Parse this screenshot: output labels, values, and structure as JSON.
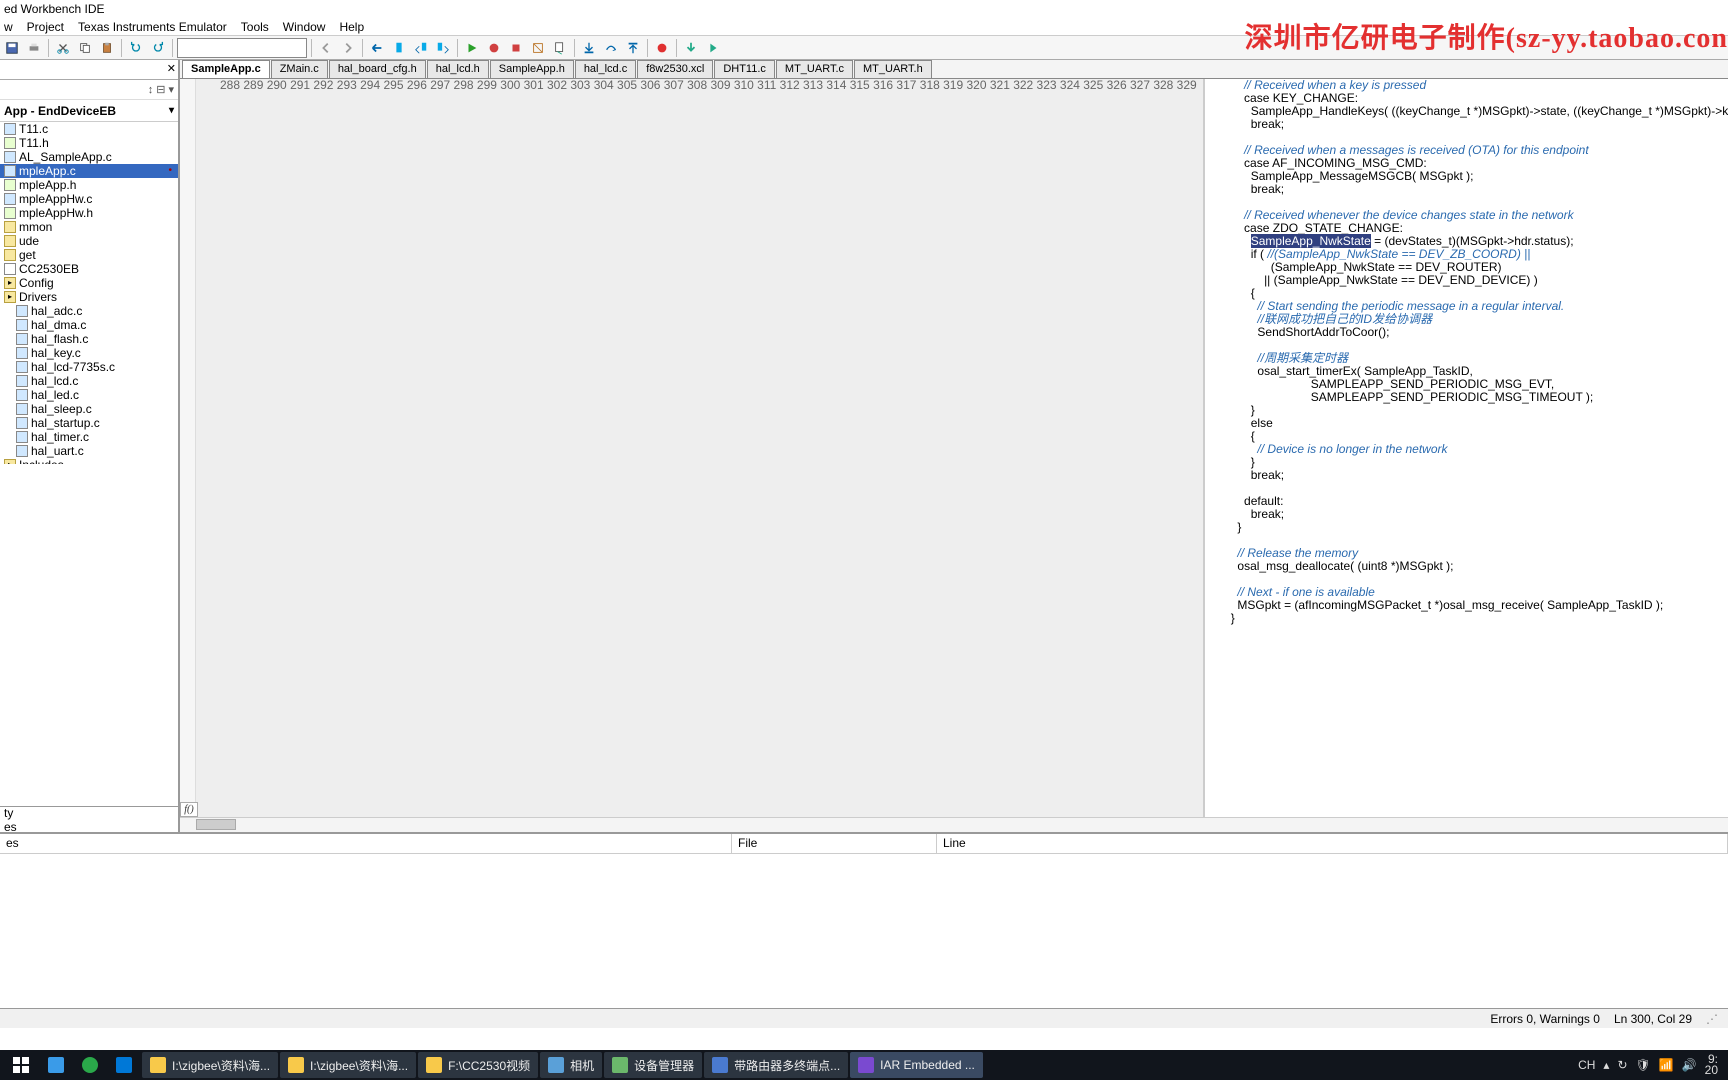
{
  "title": "ed Workbench IDE",
  "watermark": "深圳市亿研电子制作(sz-yy.taobao.con",
  "menu": [
    "w",
    "Project",
    "Texas Instruments Emulator",
    "Tools",
    "Window",
    "Help"
  ],
  "project_label": "App - EndDeviceEB",
  "tree": [
    {
      "n": "T11.c",
      "t": "c"
    },
    {
      "n": "T11.h",
      "t": "h"
    },
    {
      "n": "AL_SampleApp.c",
      "t": "c"
    },
    {
      "n": "mpleApp.c",
      "t": "c",
      "active": true,
      "mark": "•"
    },
    {
      "n": "mpleApp.h",
      "t": "h"
    },
    {
      "n": "mpleAppHw.c",
      "t": "c"
    },
    {
      "n": "mpleAppHw.h",
      "t": "h"
    }
  ],
  "folders1": [
    {
      "n": "mmon"
    },
    {
      "n": "ude"
    },
    {
      "n": "get"
    },
    {
      "n": "CC2530EB",
      "plain": true
    },
    {
      "n": "Config",
      "fold": true
    },
    {
      "n": "Drivers",
      "fold": true
    }
  ],
  "drivers": [
    {
      "n": "hal_adc.c"
    },
    {
      "n": "hal_dma.c"
    },
    {
      "n": "hal_flash.c"
    },
    {
      "n": "hal_key.c"
    },
    {
      "n": "hal_lcd-7735s.c"
    },
    {
      "n": "hal_lcd.c"
    },
    {
      "n": "hal_led.c"
    },
    {
      "n": "hal_sleep.c"
    },
    {
      "n": "hal_startup.c"
    },
    {
      "n": "hal_timer.c"
    },
    {
      "n": "hal_uart.c"
    }
  ],
  "folders2": [
    {
      "n": "Includes",
      "fold": true
    }
  ],
  "sidebot": [
    "ty",
    "es"
  ],
  "tabs": [
    "SampleApp.c",
    "ZMain.c",
    "hal_board_cfg.h",
    "hal_lcd.h",
    "SampleApp.h",
    "hal_lcd.c",
    "f8w2530.xcl",
    "DHT11.c",
    "MT_UART.c",
    "MT_UART.h"
  ],
  "active_tab": 0,
  "code_start": 288,
  "code_lines": [
    {
      "t": "          // Received when a key is pressed",
      "cm": [
        10,
        80
      ]
    },
    {
      "t": "          case KEY_CHANGE:"
    },
    {
      "t": "            SampleApp_HandleKeys( ((keyChange_t *)MSGpkt)->state, ((keyChange_t *)MSGpkt)->keys );"
    },
    {
      "t": "            break;"
    },
    {
      "t": ""
    },
    {
      "t": "          // Received when a messages is received (OTA) for this endpoint",
      "cm": [
        10,
        100
      ]
    },
    {
      "t": "          case AF_INCOMING_MSG_CMD:"
    },
    {
      "t": "            SampleApp_MessageMSGCB( MSGpkt );"
    },
    {
      "t": "            break;"
    },
    {
      "t": ""
    },
    {
      "t": "          // Received whenever the device changes state in the network",
      "cm": [
        10,
        100
      ]
    },
    {
      "t": "          case ZDO_STATE_CHANGE:"
    },
    {
      "hl": "SampleApp_NwkState",
      "pre": "            ",
      "post": " = (devStates_t)(MSGpkt->hdr.status);",
      "cur": true
    },
    {
      "t": "            if ( //(SampleApp_NwkState == DEV_ZB_COORD) ||",
      "cm": [
        17,
        80
      ]
    },
    {
      "t": "                  (SampleApp_NwkState == DEV_ROUTER)"
    },
    {
      "t": "                || (SampleApp_NwkState == DEV_END_DEVICE) )"
    },
    {
      "t": "            {"
    },
    {
      "t": "              // Start sending the periodic message in a regular interval.",
      "cm": [
        14,
        100
      ]
    },
    {
      "t": "              //联网成功把自己的ID发给协调器",
      "cm": [
        14,
        60
      ]
    },
    {
      "t": "              SendShortAddrToCoor();"
    },
    {
      "t": ""
    },
    {
      "t": "              //周期采集定时器",
      "cm": [
        14,
        40
      ]
    },
    {
      "t": "              osal_start_timerEx( SampleApp_TaskID,"
    },
    {
      "t": "                              SAMPLEAPP_SEND_PERIODIC_MSG_EVT,"
    },
    {
      "t": "                              SAMPLEAPP_SEND_PERIODIC_MSG_TIMEOUT );"
    },
    {
      "t": "            }"
    },
    {
      "t": "            else"
    },
    {
      "t": "            {"
    },
    {
      "t": "              // Device is no longer in the network",
      "cm": [
        14,
        80
      ]
    },
    {
      "t": "            }"
    },
    {
      "t": "            break;"
    },
    {
      "t": ""
    },
    {
      "t": "          default:"
    },
    {
      "t": "            break;"
    },
    {
      "t": "        }"
    },
    {
      "t": ""
    },
    {
      "t": "        // Release the memory",
      "cm": [
        8,
        60
      ]
    },
    {
      "t": "        osal_msg_deallocate( (uint8 *)MSGpkt );"
    },
    {
      "t": ""
    },
    {
      "t": "        // Next - if one is available",
      "cm": [
        8,
        60
      ]
    },
    {
      "t": "        MSGpkt = (afIncomingMSGPacket_t *)osal_msg_receive( SampleApp_TaskID );"
    },
    {
      "t": "      }"
    }
  ],
  "bottom_cols": {
    "a": "es",
    "b": "File",
    "c": "Line"
  },
  "status": {
    "err": "Errors 0, Warnings 0",
    "pos": "Ln 300, Col 29"
  },
  "taskbar": [
    {
      "label": "I:\\zigbee\\资料\\海...",
      "c": "#f8c94a"
    },
    {
      "label": "I:\\zigbee\\资料\\海...",
      "c": "#f8c94a"
    },
    {
      "label": "F:\\CC2530视频",
      "c": "#f8c94a"
    },
    {
      "label": "相机",
      "c": "#5aa0d8"
    },
    {
      "label": "设备管理器",
      "c": "#6bb86b"
    },
    {
      "label": "带路由器多终端点...",
      "c": "#4a7ad0"
    },
    {
      "label": "IAR Embedded ...",
      "c": "#7a4ad0",
      "active": true
    }
  ],
  "tray_lang": "CH",
  "clock": {
    "t": "9:",
    "d": "20"
  }
}
